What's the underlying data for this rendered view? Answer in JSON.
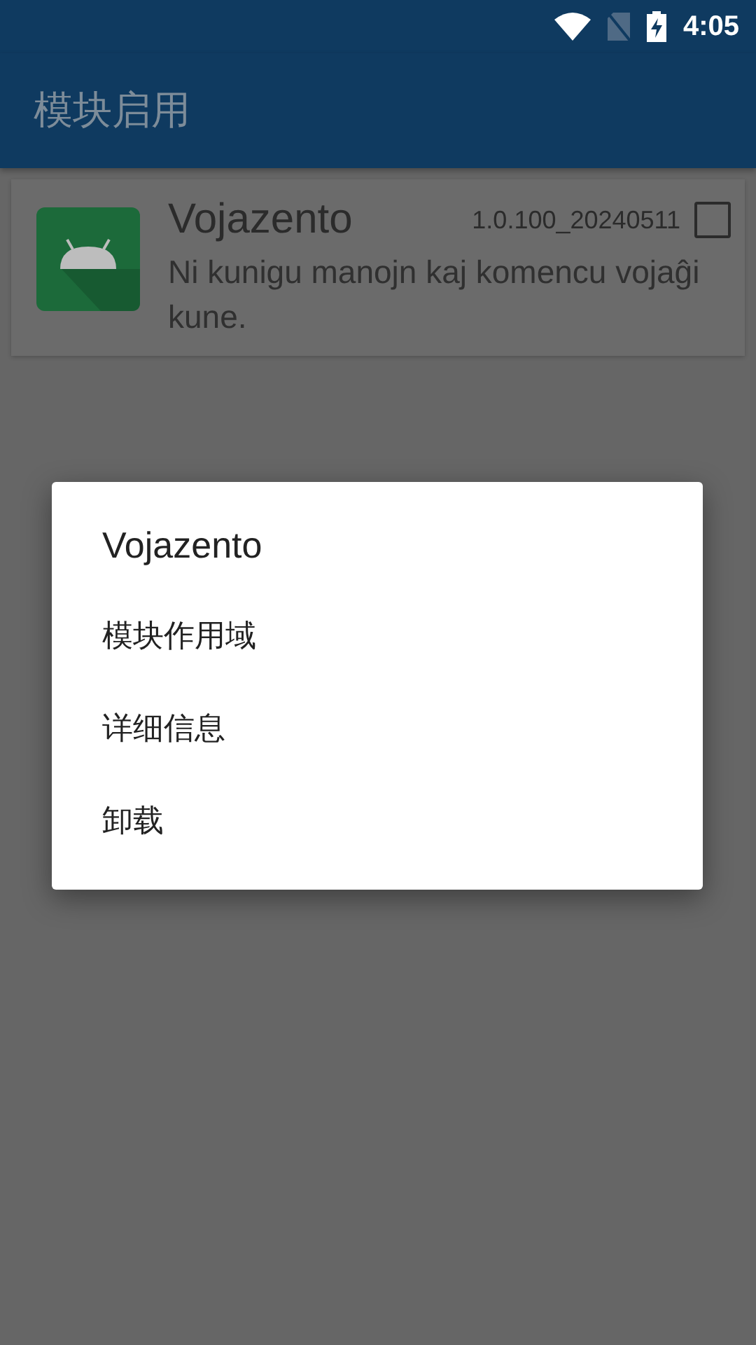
{
  "status_bar": {
    "time": "4:05"
  },
  "app_bar": {
    "title": "模块启用"
  },
  "modules": [
    {
      "name": "Vojazento",
      "version": "1.0.100_20240511",
      "description": "Ni kunigu manojn kaj komencu vojaĝi kune.",
      "checked": false
    }
  ],
  "dialog": {
    "title": "Vojazento",
    "items": [
      "模块作用域",
      "详细信息",
      "卸载"
    ]
  }
}
